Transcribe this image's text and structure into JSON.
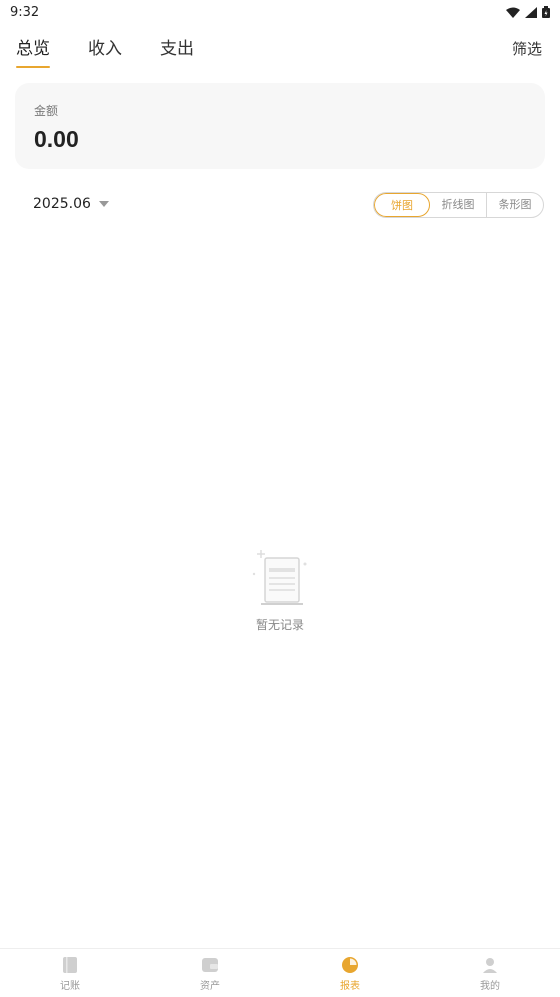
{
  "status_bar": {
    "time": "9:32"
  },
  "top_tabs": [
    {
      "label": "总览",
      "active": true
    },
    {
      "label": "收入",
      "active": false
    },
    {
      "label": "支出",
      "active": false
    }
  ],
  "filter_label": "筛选",
  "summary": {
    "label": "金额",
    "amount": "0.00"
  },
  "period": {
    "value": "2025.06"
  },
  "chart_modes": [
    {
      "label": "饼图",
      "active": true
    },
    {
      "label": "折线图",
      "active": false
    },
    {
      "label": "条形图",
      "active": false
    }
  ],
  "empty_state": {
    "icon": "document-icon",
    "text": "暂无记录"
  },
  "bottom_nav": [
    {
      "label": "记账",
      "icon": "book-icon",
      "active": false
    },
    {
      "label": "资产",
      "icon": "wallet-icon",
      "active": false
    },
    {
      "label": "报表",
      "icon": "pie-chart-icon",
      "active": true
    },
    {
      "label": "我的",
      "icon": "user-icon",
      "active": false
    }
  ],
  "colors": {
    "accent": "#e8a62f",
    "muted": "#999999",
    "card": "#f7f7f7"
  }
}
